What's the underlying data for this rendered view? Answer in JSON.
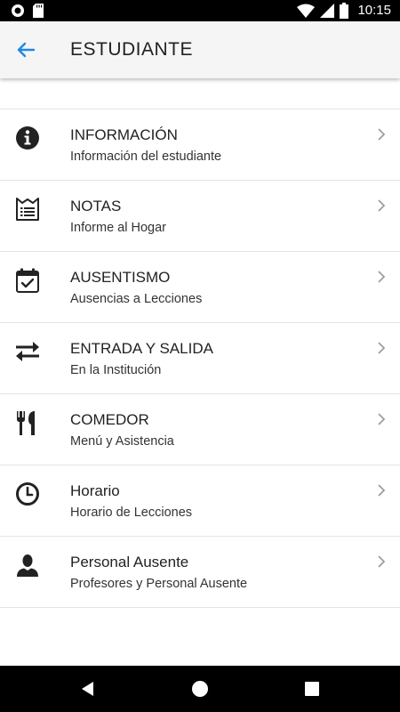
{
  "status_bar": {
    "time": "10:15",
    "icons": [
      "notification-circle-icon",
      "sd-card-icon",
      "wifi-icon",
      "signal-icon",
      "battery-icon"
    ]
  },
  "app_bar": {
    "title": "ESTUDIANTE",
    "back_icon": "arrow-left-icon",
    "accent_color": "#1e88e5"
  },
  "menu": {
    "items": [
      {
        "title": "INFORMACIÓN",
        "subtitle": "Información del estudiante",
        "icon": "info-icon"
      },
      {
        "title": "NOTAS",
        "subtitle": "Informe al Hogar",
        "icon": "report-icon"
      },
      {
        "title": "AUSENTISMO",
        "subtitle": "Ausencias a Lecciones",
        "icon": "calendar-check-icon"
      },
      {
        "title": "ENTRADA Y SALIDA",
        "subtitle": "En la Institución",
        "icon": "swap-arrows-icon"
      },
      {
        "title": "COMEDOR",
        "subtitle": "Menú y Asistencia",
        "icon": "cutlery-icon"
      },
      {
        "title": "Horario",
        "subtitle": "Horario de Lecciones",
        "icon": "clock-icon"
      },
      {
        "title": "Personal Ausente",
        "subtitle": "Profesores y Personal Ausente",
        "icon": "person-icon"
      }
    ]
  },
  "nav_bar": {
    "icons": [
      "back-triangle-icon",
      "home-circle-icon",
      "recents-square-icon"
    ]
  }
}
